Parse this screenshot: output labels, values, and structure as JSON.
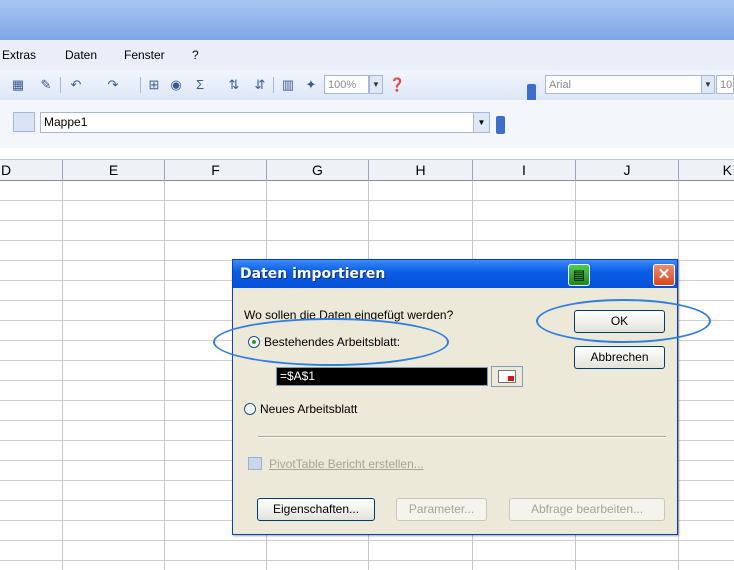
{
  "menu": {
    "items": [
      "Extras",
      "Daten",
      "Fenster",
      "?"
    ],
    "extras": "Extras",
    "daten": "Daten",
    "fenster": "Fenster",
    "help": "?"
  },
  "toolbar": {
    "zoom": "100%",
    "font": "Arial",
    "font_size": "10"
  },
  "namebox": {
    "value": "Mappe1"
  },
  "sheet": {
    "columns": [
      "D",
      "E",
      "F",
      "G",
      "H",
      "I",
      "J",
      "K"
    ]
  },
  "dialog": {
    "title": "Daten importieren",
    "question": "Wo sollen die Daten eingefügt werden?",
    "option_existing": "Bestehendes Arbeitsblatt:",
    "option_existing_selected": true,
    "reference": "=$A$1",
    "option_new": "Neues Arbeitsblatt",
    "pivot": "PivotTable Bericht erstellen...",
    "ok": "OK",
    "cancel": "Abbrechen",
    "properties": "Eigenschaften...",
    "parameters": "Parameter...",
    "edit_query": "Abfrage bearbeiten..."
  },
  "colors": {
    "dialog_title": "#0a5fe6",
    "highlight_ellipse": "#2f7fe0",
    "dialog_face": "#ece9d8"
  }
}
